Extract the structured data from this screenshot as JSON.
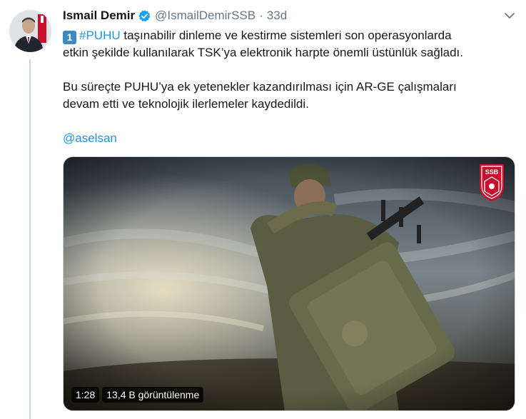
{
  "tweet": {
    "author_name": "Ismail Demir",
    "handle": "@IsmailDemirSSB",
    "separator": "·",
    "time": "33d",
    "number_emoji": "1",
    "hashtag": "#PUHU",
    "line1_rest": " taşınabilir dinleme ve kestirme sistemleri son operasyonlarda",
    "line2": "etkin şekilde kullanılarak TSK’ya elektronik harpte önemli üstünlük sağladı.",
    "para2_line1": "Bu süreçte PUHU’ya ek yetenekler kazandırılması için AR-GE çalışmaları",
    "para2_line2": "devam etti ve teknolojik ilerlemeler kaydedildi.",
    "mention": "@aselsan"
  },
  "video": {
    "duration": "1:28",
    "views": "13,4 B görüntülenme",
    "watermark": "SSB"
  },
  "icons": {
    "verified": "verified-badge-icon",
    "caret": "chevron-down-icon"
  },
  "colors": {
    "link": "#1b95e0",
    "verified": "#1da1f2",
    "secondary_text": "#657786",
    "thread_line": "#ccd6dd"
  }
}
